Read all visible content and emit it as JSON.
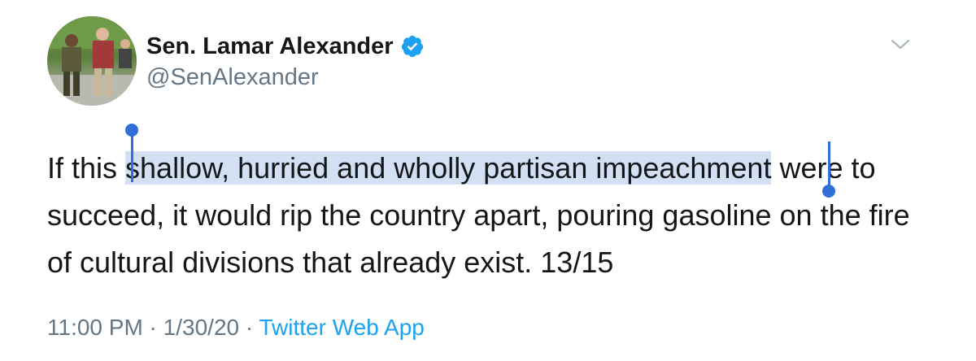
{
  "author": {
    "name": "Sen. Lamar Alexander",
    "handle": "@SenAlexander",
    "verified_icon": "verified-badge-icon",
    "accent": "#1da1f2"
  },
  "tweet": {
    "text_before": "If this ",
    "text_selected": "shallow, hurried and wholly partisan impeachment",
    "text_after": " were to succeed, it would rip the country apart, pouring gasoline on the fire of cultural divisions that already exist. 13/15",
    "selection_color": "#d3e0f3",
    "cursor_color": "#2f6fd7"
  },
  "meta": {
    "time": "11:00 PM",
    "separator1": " · ",
    "date": "1/30/20",
    "separator2": " · ",
    "app": "Twitter Web App"
  },
  "menu": {
    "icon": "chevron-down-icon"
  }
}
